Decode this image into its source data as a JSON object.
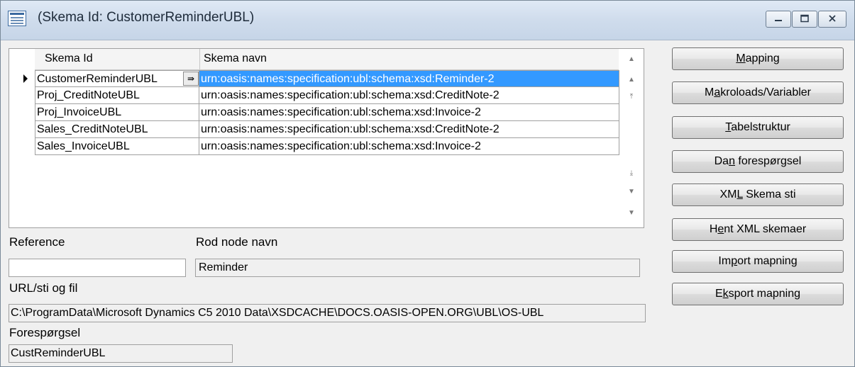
{
  "window": {
    "title": "(Skema Id: CustomerReminderUBL)",
    "icon": "form-window-icon",
    "controls": {
      "minimize": "minimize-icon",
      "maximize": "maximize-icon",
      "close": "close-icon"
    }
  },
  "grid": {
    "columns": [
      "Skema Id",
      "Skema navn"
    ],
    "rows": [
      {
        "id": "CustomerReminderUBL",
        "name": "urn:oasis:names:specification:ubl:schema:xsd:Reminder-2",
        "current": true
      },
      {
        "id": "Proj_CreditNoteUBL",
        "name": "urn:oasis:names:specification:ubl:schema:xsd:CreditNote-2"
      },
      {
        "id": "Proj_InvoiceUBL",
        "name": "urn:oasis:names:specification:ubl:schema:xsd:Invoice-2"
      },
      {
        "id": "Sales_CreditNoteUBL",
        "name": "urn:oasis:names:specification:ubl:schema:xsd:CreditNote-2"
      },
      {
        "id": "Sales_InvoiceUBL",
        "name": "urn:oasis:names:specification:ubl:schema:xsd:Invoice-2"
      }
    ],
    "lookup_glyph": "⇛"
  },
  "fields": {
    "reference_label": "Reference",
    "reference_value": "",
    "root_node_label": "Rod node navn",
    "root_node_value": "Reminder",
    "url_label": "URL/sti og fil",
    "url_value": "C:\\ProgramData\\Microsoft Dynamics C5 2010 Data\\XSDCACHE\\DOCS.OASIS-OPEN.ORG\\UBL\\OS-UBL",
    "query_label": "Forespørgsel",
    "query_value": "CustReminderUBL"
  },
  "buttons": [
    {
      "pre": "",
      "key": "M",
      "post": "apping"
    },
    {
      "pre": "M",
      "key": "a",
      "post": "kroloads/Variabler"
    },
    {
      "pre": "",
      "key": "T",
      "post": "abelstruktur"
    },
    {
      "pre": "Da",
      "key": "n",
      "post": " forespørgsel"
    },
    {
      "pre": "XM",
      "key": "L",
      "post": " Skema sti"
    },
    {
      "pre": "H",
      "key": "e",
      "post": "nt XML skemaer"
    },
    {
      "pre": "Im",
      "key": "p",
      "post": "ort mapning"
    },
    {
      "pre": "E",
      "key": "k",
      "post": "sport mapning"
    }
  ]
}
